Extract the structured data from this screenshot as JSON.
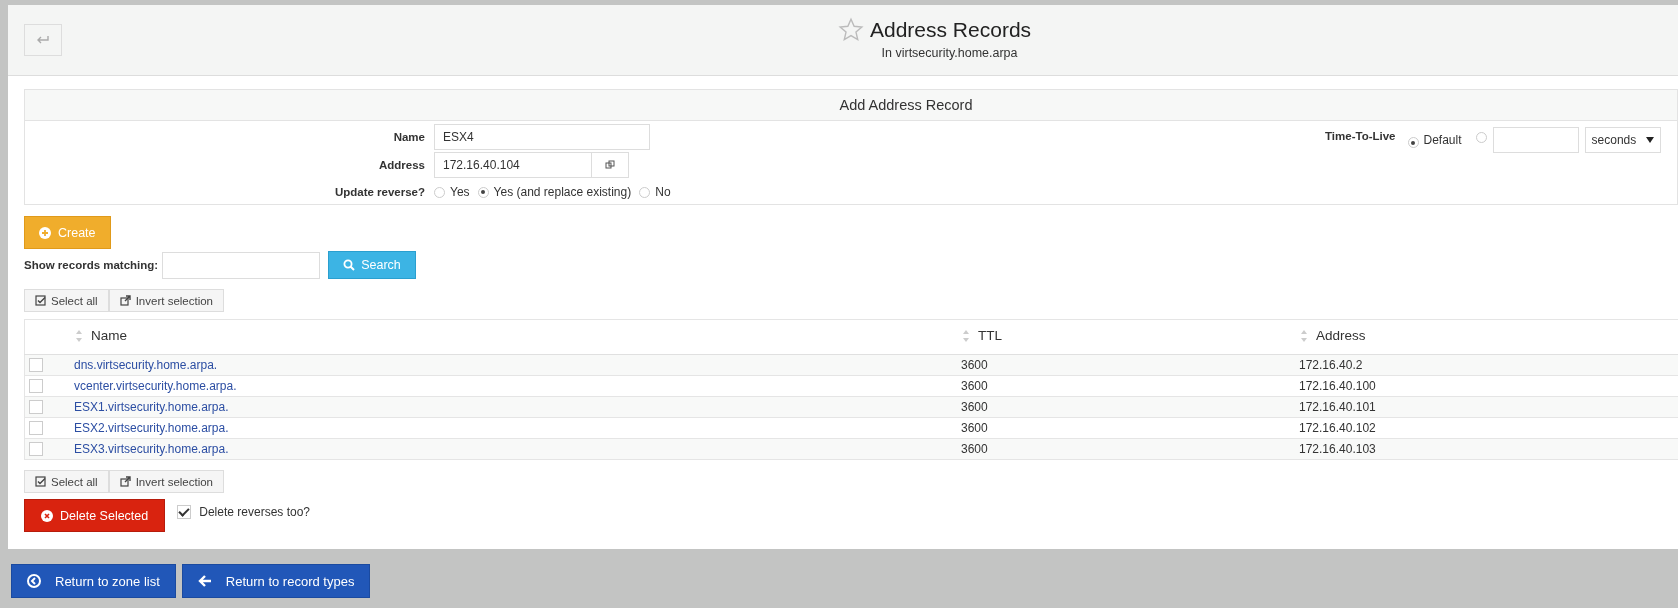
{
  "header": {
    "title": "Address Records",
    "subtitle": "In virtsecurity.home.arpa"
  },
  "form": {
    "title": "Add Address Record",
    "name": {
      "label": "Name",
      "value": "ESX4"
    },
    "address": {
      "label": "Address",
      "value": "172.16.40.104"
    },
    "reverse": {
      "label": "Update reverse?",
      "options": [
        {
          "label": "Yes",
          "selected": false
        },
        {
          "label": "Yes (and replace existing)",
          "selected": true
        },
        {
          "label": "No",
          "selected": false
        }
      ]
    },
    "ttl": {
      "label": "Time-To-Live",
      "default_label": "Default",
      "default_selected": true,
      "custom_selected": false,
      "unit": "seconds"
    }
  },
  "create_button": "Create",
  "search": {
    "label": "Show records matching:",
    "button": "Search"
  },
  "select_all": "Select all",
  "invert_selection": "Invert selection",
  "table": {
    "columns": [
      "Name",
      "TTL",
      "Address"
    ],
    "rows": [
      {
        "checked": false,
        "name": "dns.virtsecurity.home.arpa.",
        "ttl": "3600",
        "address": "172.16.40.2"
      },
      {
        "checked": false,
        "name": "vcenter.virtsecurity.home.arpa.",
        "ttl": "3600",
        "address": "172.16.40.100"
      },
      {
        "checked": false,
        "name": "ESX1.virtsecurity.home.arpa.",
        "ttl": "3600",
        "address": "172.16.40.101"
      },
      {
        "checked": false,
        "name": "ESX2.virtsecurity.home.arpa.",
        "ttl": "3600",
        "address": "172.16.40.102"
      },
      {
        "checked": false,
        "name": "ESX3.virtsecurity.home.arpa.",
        "ttl": "3600",
        "address": "172.16.40.103"
      }
    ]
  },
  "select_all_2": "Select all",
  "invert_selection_2": "Invert selection",
  "delete_button": "Delete Selected",
  "delete_reverses": {
    "label": "Delete reverses too?",
    "checked": true
  },
  "footer_buttons": [
    "Return to zone list",
    "Return to record types"
  ]
}
